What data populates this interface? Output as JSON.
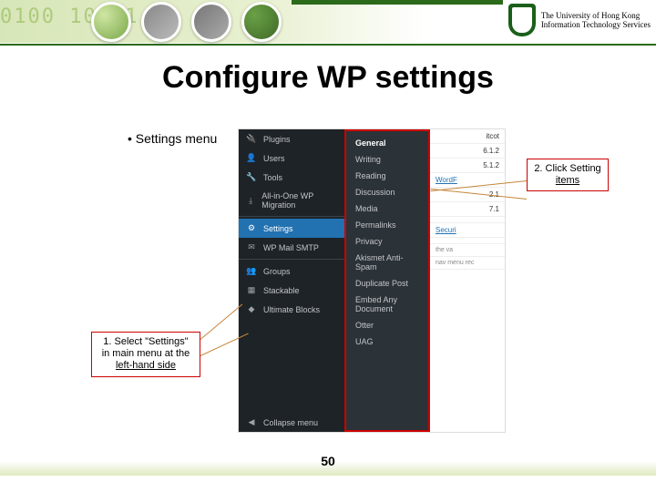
{
  "banner": {
    "binary": "0100    10001",
    "org_line1": "The University of Hong Kong",
    "org_line2": "Information Technology Services"
  },
  "title": "Configure WP settings",
  "bullet": "Settings menu",
  "callout1": {
    "t_line1": "1. Select \"Settings\"",
    "t_line2": "in main menu at the",
    "t_line3": "left-hand side"
  },
  "callout2": {
    "t_line1": "2. Click Setting",
    "t_line2": "items"
  },
  "wp": {
    "side": [
      {
        "icon": "🔌",
        "label": "Plugins"
      },
      {
        "icon": "👤",
        "label": "Users"
      },
      {
        "icon": "🔧",
        "label": "Tools"
      },
      {
        "icon": "⤓",
        "label": "All-in-One WP Migration"
      },
      {
        "icon": "⚙",
        "label": "Settings",
        "active": true
      },
      {
        "icon": "✉",
        "label": "WP Mail SMTP"
      },
      {
        "icon": "👥",
        "label": "Groups"
      },
      {
        "icon": "▦",
        "label": "Stackable"
      },
      {
        "icon": "◆",
        "label": "Ultimate Blocks"
      },
      {
        "icon": "◀",
        "label": "Collapse menu",
        "collapse": true
      }
    ],
    "submenu": [
      "General",
      "Writing",
      "Reading",
      "Discussion",
      "Media",
      "Permalinks",
      "Privacy",
      "Akismet Anti-Spam",
      "Duplicate Post",
      "Embed Any Document",
      "Otter",
      "UAG"
    ],
    "right": [
      {
        "a": "",
        "b": "itcot"
      },
      {
        "a": "",
        "b": "6.1.2"
      },
      {
        "a": "",
        "b": "5.1.2"
      },
      {
        "a": "WordF",
        "b": ""
      },
      {
        "a": "",
        "b": "2.1"
      },
      {
        "a": "",
        "b": "7.1"
      },
      {
        "a": "",
        "b": ""
      },
      {
        "a": "Securi",
        "b": ""
      },
      {
        "a": "",
        "b": ""
      },
      {
        "a": "the va",
        "b": ""
      },
      {
        "a": "nav menu rec",
        "b": ""
      }
    ]
  },
  "page_number": "50"
}
